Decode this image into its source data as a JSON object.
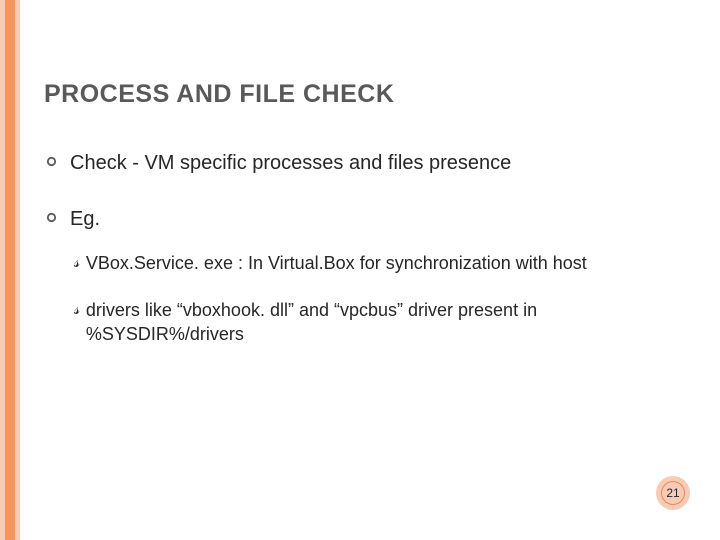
{
  "slide": {
    "title": "PROCESS AND FILE CHECK",
    "page_number": "21"
  },
  "bullets": {
    "item0": "Check - VM specific processes and files presence",
    "item1": "Eg.",
    "sub0": "VBox.Service. exe : In Virtual.Box for synchronization with host",
    "sub1": "drivers like “vboxhook. dll” and “vpcbus” driver  present in %SYSDIR%/drivers"
  },
  "theme": {
    "accent_light": "#f8cbb6",
    "accent_dark": "#f2955f",
    "title_color": "#595959"
  }
}
